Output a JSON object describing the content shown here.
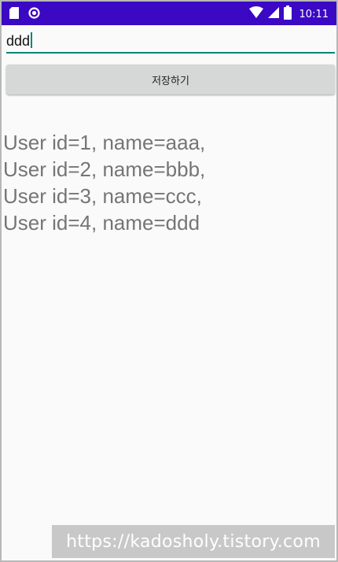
{
  "status_bar": {
    "time": "10:11",
    "background_color": "#3b09c4",
    "left_icons": [
      "sd-card-icon",
      "sync-circle-icon"
    ],
    "right_icons": [
      "wifi-icon",
      "signal-icon",
      "battery-icon"
    ]
  },
  "input": {
    "value": "ddd",
    "accent_color": "#008577"
  },
  "save_button": {
    "label": "저장하기"
  },
  "users": {
    "lines": [
      "User id=1, name=aaa,",
      "User id=2, name=bbb,",
      "User id=3, name=ccc,",
      "User id=4, name=ddd"
    ]
  },
  "watermark": {
    "text": "https://kadosholy.tistory.com"
  }
}
